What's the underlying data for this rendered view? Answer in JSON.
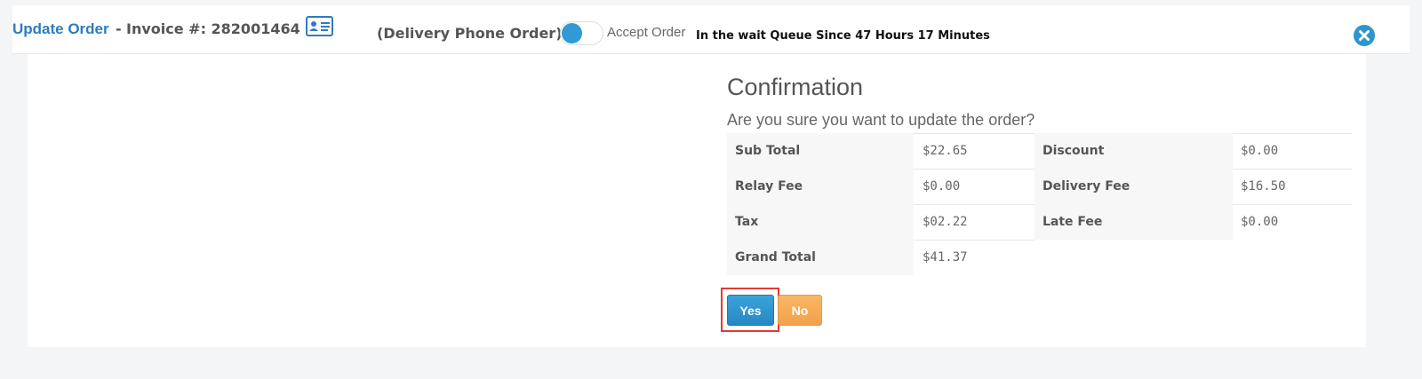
{
  "header": {
    "title_link": "Update Order",
    "title_separator": "-",
    "invoice_text": "Invoice #: 282001464",
    "contact_icon": "contact-card-icon",
    "order_type": "(Delivery Phone Order)",
    "toggle_label": "Accept Order",
    "wait_queue": "In the wait Queue Since 47 Hours 17 Minutes",
    "close_icon": "close-circle-icon"
  },
  "dialog": {
    "title": "Confirmation",
    "message": "Are you sure you want to update the order?",
    "summary": [
      {
        "label_left": "Sub Total",
        "value_left": "$22.65",
        "label_right": "Discount",
        "value_right": "$0.00"
      },
      {
        "label_left": "Relay Fee",
        "value_left": "$0.00",
        "label_right": "Delivery Fee",
        "value_right": "$16.50"
      },
      {
        "label_left": "Tax",
        "value_left": "$02.22",
        "label_right": "Late Fee",
        "value_right": "$0.00"
      },
      {
        "label_left": "Grand Total",
        "value_left": "$41.37"
      }
    ],
    "yes_label": "Yes",
    "no_label": "No"
  },
  "colors": {
    "link_blue": "#2f7bbf",
    "toggle_blue": "#2f9ad3",
    "yes_button": "#2f95cf",
    "no_button": "#f4a752",
    "highlight_red": "#e03b32"
  }
}
